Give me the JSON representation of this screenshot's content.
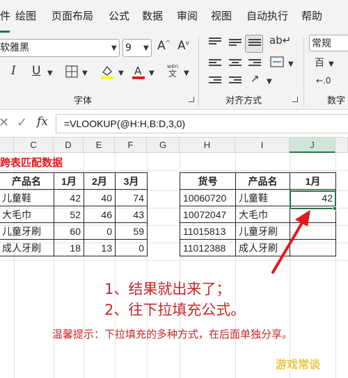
{
  "menu": {
    "items": [
      "绘图",
      "页面布局",
      "公式",
      "数据",
      "审阅",
      "视图",
      "自动执行",
      "帮助"
    ],
    "active_prefix": "件"
  },
  "ribbon": {
    "font_name": "软雅黑",
    "font_size": "9",
    "grow_font_icon": "A^",
    "shrink_font_icon": "A˅",
    "italic": "I",
    "underline": "U",
    "phonetic_top": "wén",
    "phonetic_bottom": "文",
    "font_group_label": "字体",
    "align_group_label": "对齐方式",
    "number_format": "常规",
    "number_group_label": "数字",
    "number_partial": "百"
  },
  "formula_bar": {
    "fx": "fx",
    "formula": "=VLOOKUP(@H:H,B:D,3,0)"
  },
  "columns": [
    "C",
    "D",
    "E",
    "F",
    "G",
    "H",
    "I",
    "J"
  ],
  "selected_column": "J",
  "sheet_title": "跨表匹配数据",
  "left_table": {
    "headers": [
      "产品名",
      "1月",
      "2月",
      "3月"
    ],
    "rows": [
      [
        "儿童鞋",
        "42",
        "40",
        "74"
      ],
      [
        "大毛巾",
        "52",
        "46",
        "43"
      ],
      [
        "儿童牙刷",
        "60",
        "0",
        "59"
      ],
      [
        "成人牙刷",
        "18",
        "13",
        "0"
      ]
    ]
  },
  "right_table": {
    "headers": [
      "货号",
      "产品名",
      "1月"
    ],
    "rows": [
      [
        "10060720",
        "儿童鞋",
        "42"
      ],
      [
        "10072047",
        "大毛巾",
        ""
      ],
      [
        "11015813",
        "儿童牙刷",
        ""
      ],
      [
        "11012388",
        "成人牙刷",
        ""
      ]
    ]
  },
  "notes": {
    "line1": "1、结果就出来了；",
    "line2": "2、往下拉填充公式。",
    "tip": "温馨提示：下拉填充的多种方式，在后面单独分享。"
  },
  "watermark": "游戏常谈",
  "colors": {
    "accent": "#217346",
    "note_red": "#c9262a",
    "title_red": "#e0191e",
    "arrow_red": "#e0191e"
  }
}
